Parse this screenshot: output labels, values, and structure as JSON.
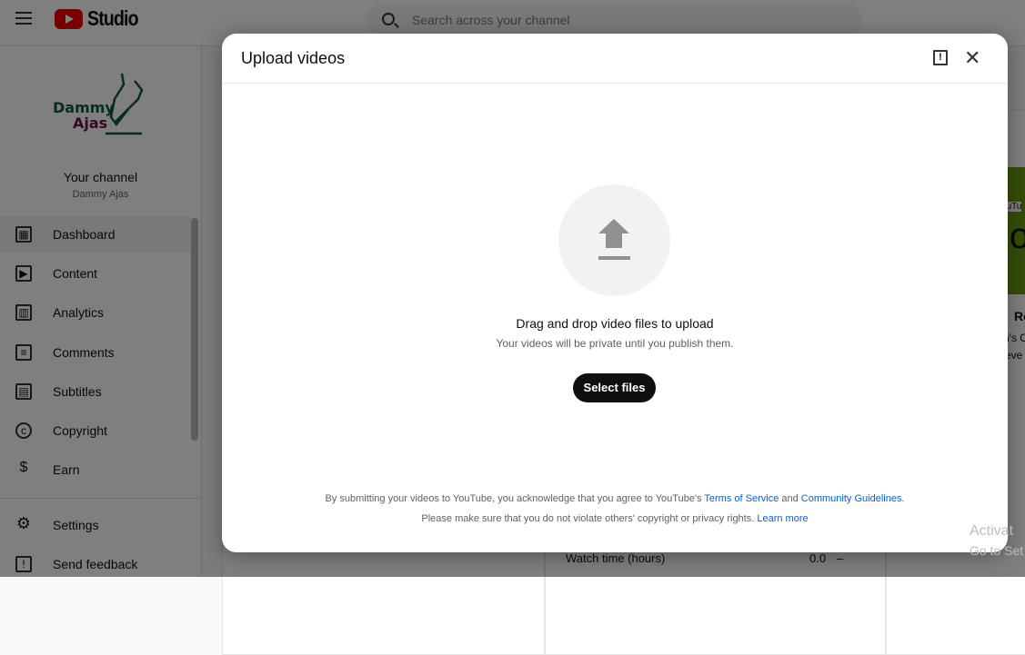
{
  "header": {
    "app_name": "Studio",
    "search_placeholder": "Search across your channel"
  },
  "sidebar": {
    "channel_title": "Your channel",
    "channel_name": "Dammy Ajas",
    "logo_text": [
      "Dammy",
      "Ajas"
    ],
    "items": [
      {
        "label": "Dashboard",
        "icon": "dashboard-icon",
        "glyph": "▦",
        "active": true
      },
      {
        "label": "Content",
        "icon": "content-icon",
        "glyph": "▶"
      },
      {
        "label": "Analytics",
        "icon": "analytics-icon",
        "glyph": "▥"
      },
      {
        "label": "Comments",
        "icon": "comments-icon",
        "glyph": "≡"
      },
      {
        "label": "Subtitles",
        "icon": "subtitles-icon",
        "glyph": "▤"
      },
      {
        "label": "Copyright",
        "icon": "copyright-icon",
        "glyph": "c"
      },
      {
        "label": "Earn",
        "icon": "earn-icon",
        "glyph": "$"
      }
    ],
    "bottom": [
      {
        "label": "Settings",
        "icon": "gear-icon",
        "glyph": "⚙"
      },
      {
        "label": "Send feedback",
        "icon": "feedback-icon",
        "glyph": "!"
      }
    ]
  },
  "background": {
    "watch_time_label": "Watch time (hours)",
    "watch_time_value": "0.0",
    "watch_time_change": "–",
    "partial": [
      "ouTu",
      "Ro",
      "Rou",
      "n's C",
      "eve"
    ]
  },
  "watermark": [
    "Activat",
    "Go to Set"
  ],
  "dialog": {
    "title": "Upload videos",
    "drag_text": "Drag and drop video files to upload",
    "private_note": "Your videos will be private until you publish them.",
    "select_button": "Select files",
    "legal1_pre": "By submitting your videos to YouTube, you acknowledge that you agree to YouTube's ",
    "terms_link": "Terms of Service",
    "legal1_and": " and ",
    "guidelines_link": "Community Guidelines",
    "legal1_end": ".",
    "legal2_pre": "Please make sure that you do not violate others' copyright or privacy rights. ",
    "learn_more": "Learn more"
  },
  "colors": {
    "brand_red": "#ff0000",
    "link": "#065fd4",
    "logo_green": "#0b5d3a",
    "logo_purple": "#6b1046"
  }
}
